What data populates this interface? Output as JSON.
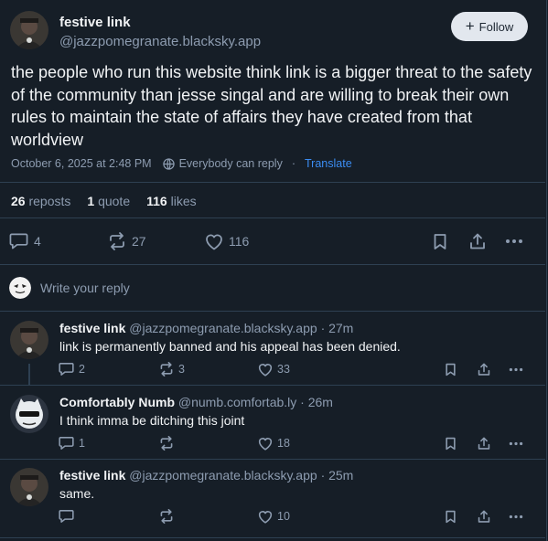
{
  "post": {
    "author_name": "festive link",
    "author_handle": "@jazzpomegranate.blacksky.app",
    "follow_label": "Follow",
    "text": "the people who run this website think link is a bigger threat to the safety of the community than jesse singal and are willing to break their own rules to maintain the state of affairs they have created from that worldview",
    "timestamp": "October 6, 2025 at 2:48 PM",
    "reply_setting": "Everybody can reply",
    "separator": "·",
    "translate_label": "Translate",
    "reposts_count": "26",
    "reposts_label": "reposts",
    "quotes_count": "1",
    "quotes_label": "quote",
    "likes_count": "116",
    "likes_label": "likes",
    "reply_count": "4",
    "repost_count": "27",
    "like_count": "116"
  },
  "compose": {
    "placeholder": "Write your reply"
  },
  "replies": [
    {
      "author_name": "festive link",
      "author_handle": "@jazzpomegranate.blacksky.app",
      "time": "· 27m",
      "text": "link is permanently banned and his appeal has been denied.",
      "reply_count": "2",
      "repost_count": "3",
      "like_count": "33"
    },
    {
      "author_name": "Comfortably Numb",
      "author_handle": "@numb.comfortab.ly",
      "time": "· 26m",
      "text": "I think imma be ditching this joint",
      "reply_count": "1",
      "repost_count": "",
      "like_count": "18"
    },
    {
      "author_name": "festive link",
      "author_handle": "@jazzpomegranate.blacksky.app",
      "time": "· 25m",
      "text": "same.",
      "reply_count": "",
      "repost_count": "",
      "like_count": "10"
    }
  ],
  "colors": {
    "background": "#161e27",
    "border": "#2e4052",
    "text": "#f1f3f5",
    "muted": "#8d9cb0",
    "link": "#3b8cf2",
    "follow_bg": "#e2e7ee"
  },
  "icons": {
    "reply": "speech-bubble-icon",
    "repost": "repost-arrows-icon",
    "like": "heart-icon",
    "bookmark": "bookmark-icon",
    "share": "share-icon",
    "more": "ellipsis-icon",
    "reply_setting": "globe-icon"
  }
}
